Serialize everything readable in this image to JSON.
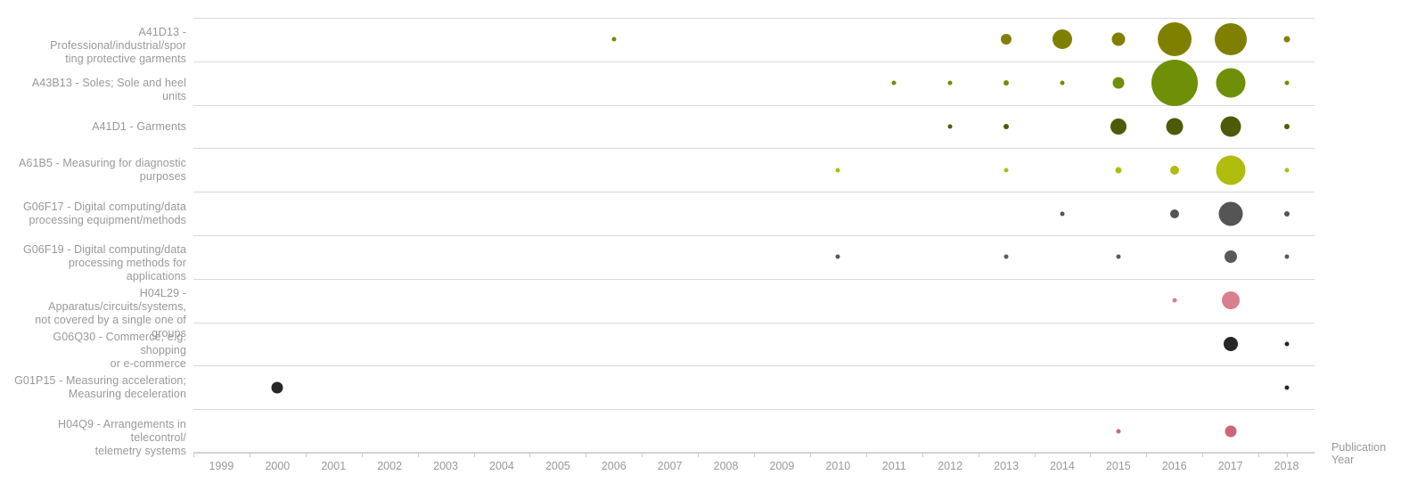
{
  "chart_data": {
    "type": "scatter",
    "subtype": "bubble-matrix",
    "title": "",
    "xlabel": "Publication Year",
    "ylabel": "",
    "grid": "row-separators-only",
    "legend": "none",
    "xlim": [
      1998.5,
      2018.5
    ],
    "x_ticks": [
      "1999",
      "2000",
      "2001",
      "2002",
      "2003",
      "2004",
      "2005",
      "2006",
      "2007",
      "2008",
      "2009",
      "2010",
      "2011",
      "2012",
      "2013",
      "2014",
      "2015",
      "2016",
      "2017",
      "2018"
    ],
    "categories": [
      "A41D13 - Professional/industrial/sporting protective garments",
      "A43B13 - Soles; Sole and heel units",
      "A41D1 - Garments",
      "A61B5 - Measuring for diagnostic purposes",
      "G06F17 - Digital computing/data processing equipment/methods",
      "G06F19 - Digital computing/data processing methods for applications",
      "H04L29 - Apparatus/circuits/systems, not covered by a single one of groups",
      "G06Q30 - Commerce, e.g. shopping or e-commerce",
      "G01P15 - Measuring acceleration; Measuring deceleration",
      "H04Q9 - Arrangements in telecontrol/telemetry systems"
    ],
    "series": [
      {
        "name": "A41D13 - Professional/industrial/sporting protective garments",
        "color": "#808000",
        "points": [
          {
            "x": 2006,
            "size": 5
          },
          {
            "x": 2013,
            "size": 12
          },
          {
            "x": 2014,
            "size": 22
          },
          {
            "x": 2015,
            "size": 15
          },
          {
            "x": 2016,
            "size": 38
          },
          {
            "x": 2017,
            "size": 36
          },
          {
            "x": 2018,
            "size": 7
          }
        ]
      },
      {
        "name": "A43B13 - Soles; Sole and heel units",
        "color": "#6f8f06",
        "points": [
          {
            "x": 2011,
            "size": 5
          },
          {
            "x": 2012,
            "size": 5
          },
          {
            "x": 2013,
            "size": 6
          },
          {
            "x": 2014,
            "size": 5
          },
          {
            "x": 2015,
            "size": 13
          },
          {
            "x": 2016,
            "size": 52
          },
          {
            "x": 2017,
            "size": 33
          },
          {
            "x": 2018,
            "size": 5
          }
        ]
      },
      {
        "name": "A41D1 - Garments",
        "color": "#4f5a08",
        "points": [
          {
            "x": 2012,
            "size": 5
          },
          {
            "x": 2013,
            "size": 6
          },
          {
            "x": 2015,
            "size": 18
          },
          {
            "x": 2016,
            "size": 19
          },
          {
            "x": 2017,
            "size": 23
          },
          {
            "x": 2018,
            "size": 6
          }
        ]
      },
      {
        "name": "A61B5 - Measuring for diagnostic purposes",
        "color": "#b0bc0e",
        "points": [
          {
            "x": 2010,
            "size": 5
          },
          {
            "x": 2013,
            "size": 5
          },
          {
            "x": 2015,
            "size": 7
          },
          {
            "x": 2016,
            "size": 10
          },
          {
            "x": 2017,
            "size": 33
          },
          {
            "x": 2018,
            "size": 5
          }
        ]
      },
      {
        "name": "G06F17 - Digital computing/data processing equipment/methods",
        "color": "#555555",
        "points": [
          {
            "x": 2014,
            "size": 5
          },
          {
            "x": 2016,
            "size": 10
          },
          {
            "x": 2017,
            "size": 27
          },
          {
            "x": 2018,
            "size": 6
          }
        ]
      },
      {
        "name": "G06F19 - Digital computing/data processing methods for applications",
        "color": "#5a5a5a",
        "points": [
          {
            "x": 2010,
            "size": 5
          },
          {
            "x": 2013,
            "size": 5
          },
          {
            "x": 2015,
            "size": 5
          },
          {
            "x": 2017,
            "size": 14
          },
          {
            "x": 2018,
            "size": 5
          }
        ]
      },
      {
        "name": "H04L29 - Apparatus/circuits/systems, not covered by a single one of groups",
        "color": "#d9808f",
        "points": [
          {
            "x": 2016,
            "size": 5
          },
          {
            "x": 2017,
            "size": 20
          }
        ]
      },
      {
        "name": "G06Q30 - Commerce, e.g. shopping or e-commerce",
        "color": "#262626",
        "points": [
          {
            "x": 2017,
            "size": 16
          },
          {
            "x": 2018,
            "size": 5
          }
        ]
      },
      {
        "name": "G01P15 - Measuring acceleration; Measuring deceleration",
        "color": "#262626",
        "points": [
          {
            "x": 2000,
            "size": 13
          },
          {
            "x": 2018,
            "size": 5
          }
        ]
      },
      {
        "name": "H04Q9 - Arrangements in telecontrol/telemetry systems",
        "color": "#cc6677",
        "points": [
          {
            "x": 2015,
            "size": 5
          },
          {
            "x": 2017,
            "size": 13
          }
        ]
      }
    ]
  },
  "axis": {
    "x_title_line1": "Publication",
    "x_title_line2": "Year"
  },
  "rows": [
    {
      "line1": "A41D13 - Professional/industrial/spor",
      "line2": "ting protective garments"
    },
    {
      "line1": "A43B13 - Soles; Sole and heel units",
      "line2": ""
    },
    {
      "line1": "A41D1 - Garments",
      "line2": ""
    },
    {
      "line1": "A61B5 - Measuring for diagnostic",
      "line2": "purposes"
    },
    {
      "line1": "G06F17 - Digital computing/data",
      "line2": "processing equipment/methods"
    },
    {
      "line1": "G06F19 - Digital computing/data",
      "line2": "processing methods for applications"
    },
    {
      "line1": "H04L29 - Apparatus/circuits/systems,",
      "line2": "not covered by a single one of groups"
    },
    {
      "line1": "G06Q30 - Commerce, e.g. shopping",
      "line2": "or e-commerce"
    },
    {
      "line1": "G01P15 - Measuring acceleration;",
      "line2": "Measuring deceleration"
    },
    {
      "line1": "H04Q9 - Arrangements in telecontrol/",
      "line2": "telemetry systems"
    }
  ]
}
